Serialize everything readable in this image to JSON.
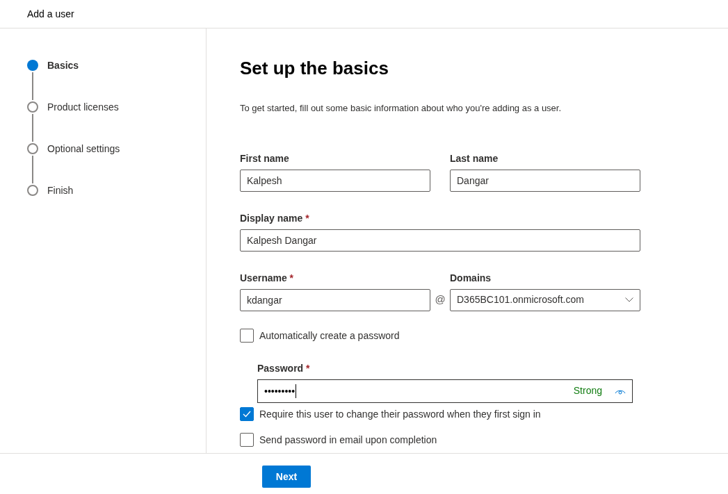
{
  "header": {
    "title": "Add a user"
  },
  "steps": [
    {
      "label": "Basics",
      "selected": true
    },
    {
      "label": "Product licenses",
      "selected": false
    },
    {
      "label": "Optional settings",
      "selected": false
    },
    {
      "label": "Finish",
      "selected": false
    }
  ],
  "heading": "Set up the basics",
  "description": "To get started, fill out some basic information about who you're adding as a user.",
  "first_name": {
    "label": "First name",
    "value": "Kalpesh"
  },
  "last_name": {
    "label": "Last name",
    "value": "Dangar"
  },
  "display_name": {
    "label": "Display name",
    "required_mark": "*",
    "value": "Kalpesh Dangar"
  },
  "username": {
    "label": "Username",
    "required_mark": "*",
    "value": "kdangar"
  },
  "at_sign": "@",
  "domains": {
    "label": "Domains",
    "value": "D365BC101.onmicrosoft.com"
  },
  "auto_password": {
    "label": "Automatically create a password",
    "checked": false
  },
  "password": {
    "label": "Password",
    "required_mark": "*",
    "value": "•••••••••",
    "strength": "Strong"
  },
  "require_change": {
    "label": "Require this user to change their password when they first sign in",
    "checked": true
  },
  "send_email": {
    "label": "Send password in email upon completion",
    "checked": false
  },
  "next_button": "Next"
}
